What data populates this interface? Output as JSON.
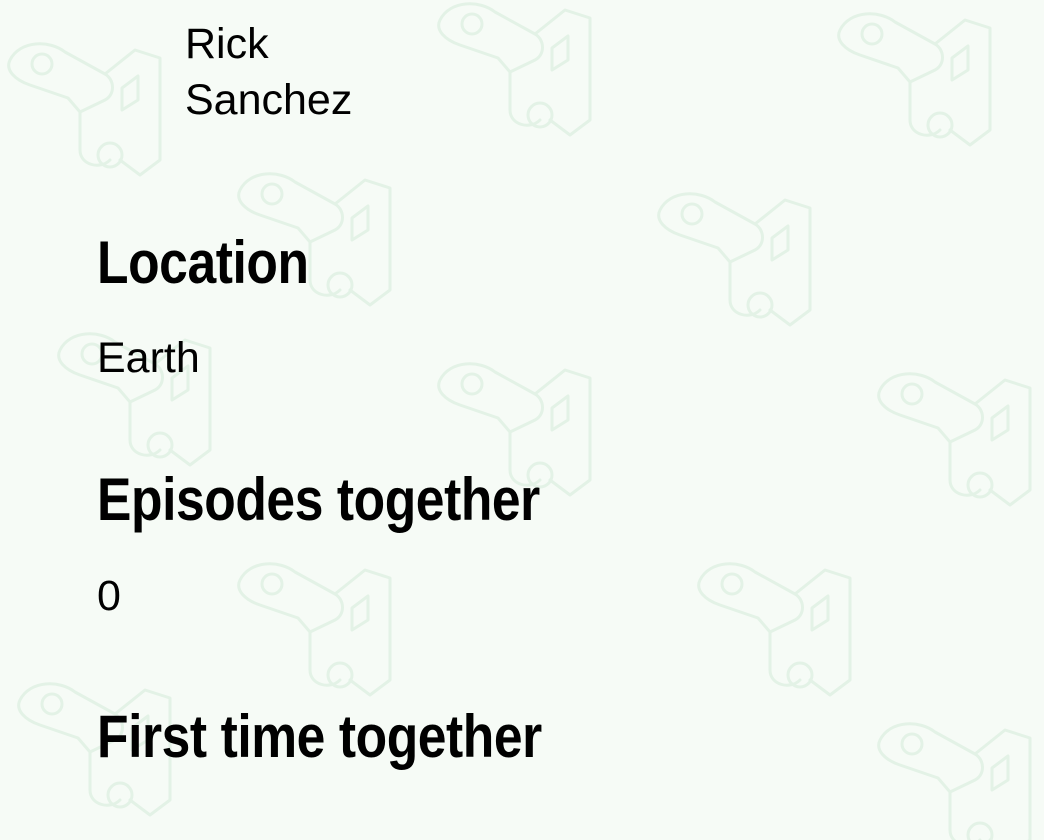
{
  "character": {
    "name": "Rick Sanchez"
  },
  "sections": {
    "location": {
      "title": "Location",
      "value": "Earth"
    },
    "episodes": {
      "title": "Episodes together",
      "value": "0"
    },
    "first_time": {
      "title": "First time together"
    }
  },
  "colors": {
    "background": "#f6fbf6",
    "pattern": "#e3f2e6",
    "text": "#000000"
  },
  "background_pattern_icon": "portal-gun-icon"
}
